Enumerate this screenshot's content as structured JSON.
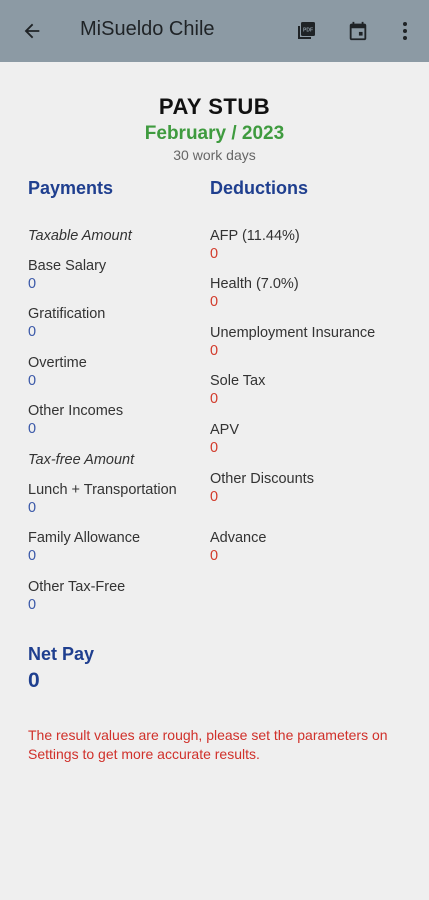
{
  "appbar": {
    "title": "MiSueldo Chile",
    "icons": [
      "back-arrow-icon",
      "pdf-icon",
      "calendar-icon",
      "more-vert-icon"
    ],
    "color": "#8c9aa4"
  },
  "stub": {
    "title": "PAY STUB",
    "period": "February / 2023",
    "work_days": "30 work days"
  },
  "payments": {
    "heading": "Payments",
    "taxable_label": "Taxable Amount",
    "base_salary": {
      "label": "Base Salary",
      "value": "0"
    },
    "gratification": {
      "label": "Gratification",
      "value": "0"
    },
    "overtime": {
      "label": "Overtime",
      "value": "0"
    },
    "other_incomes": {
      "label": "Other Incomes",
      "value": "0"
    },
    "taxfree_label": "Tax-free Amount",
    "lunch_transport": {
      "label": "Lunch + Transportation",
      "value": "0"
    },
    "family_allowance": {
      "label": "Family Allowance",
      "value": "0"
    },
    "other_taxfree": {
      "label": "Other Tax-Free",
      "value": "0"
    }
  },
  "deductions": {
    "heading": "Deductions",
    "afp": {
      "label": "AFP (11.44%)",
      "value": "0"
    },
    "health": {
      "label": "Health (7.0%)",
      "value": "0"
    },
    "unemployment": {
      "label": "Unemployment Insurance",
      "value": "0"
    },
    "sole_tax": {
      "label": "Sole Tax",
      "value": "0"
    },
    "apv": {
      "label": "APV",
      "value": "0"
    },
    "other_discounts": {
      "label": "Other Discounts",
      "value": "0"
    },
    "advance": {
      "label": "Advance",
      "value": "0"
    }
  },
  "net_pay": {
    "label": "Net Pay",
    "value": "0"
  },
  "note": "The result values are rough, please set the parameters on Settings to get more accurate results."
}
